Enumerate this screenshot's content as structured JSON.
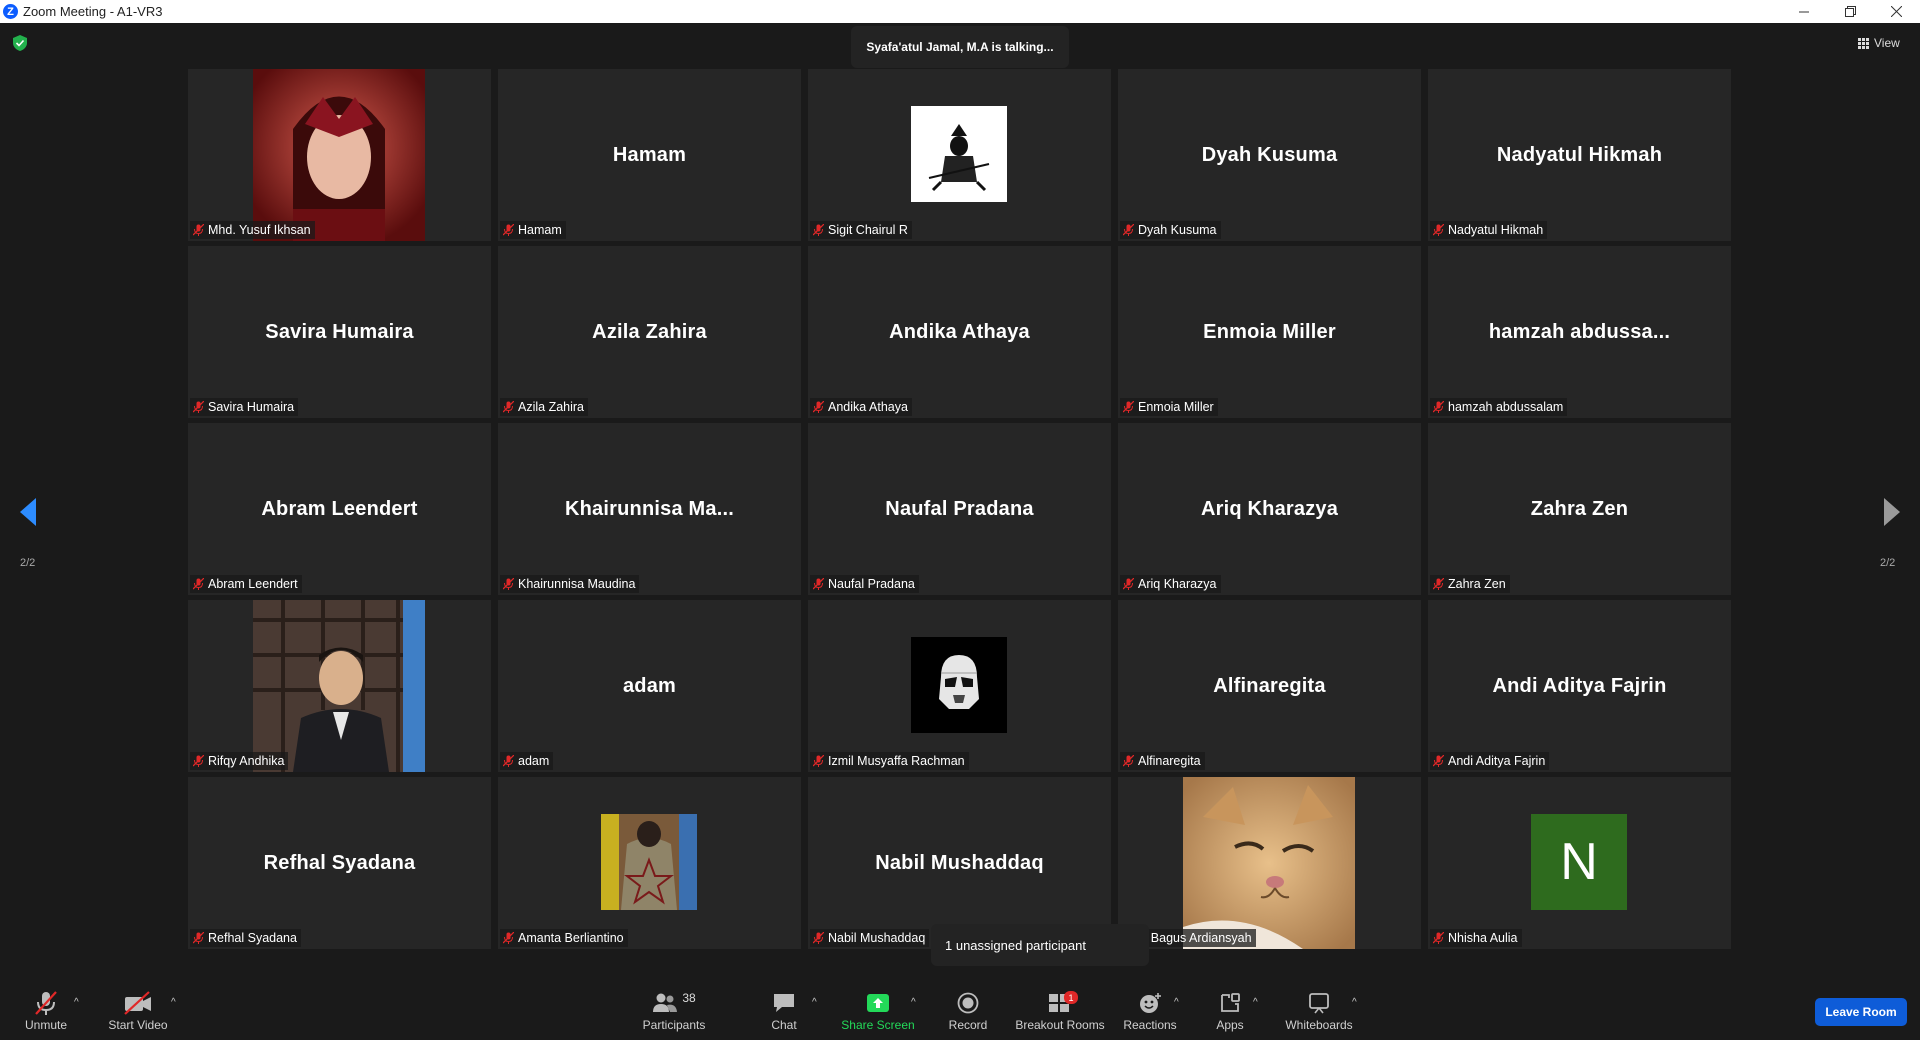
{
  "window": {
    "title": "Zoom Meeting - A1-VR3"
  },
  "banner": {
    "talking": "Syafa'atul Jamal, M.A is talking..."
  },
  "view_button": {
    "label": "View"
  },
  "pager": {
    "left": "2/2",
    "right": "2/2"
  },
  "tiles": [
    {
      "display": "",
      "nameplate": "Mhd. Yusuf Ikhsan",
      "media": "photo-scarlet-witch"
    },
    {
      "display": "Hamam",
      "nameplate": "Hamam",
      "media": "none"
    },
    {
      "display": "",
      "nameplate": "Sigit Chairul R",
      "media": "samurai-logo"
    },
    {
      "display": "Dyah Kusuma",
      "nameplate": "Dyah Kusuma",
      "media": "none"
    },
    {
      "display": "Nadyatul Hikmah",
      "nameplate": "Nadyatul Hikmah",
      "media": "none"
    },
    {
      "display": "Savira Humaira",
      "nameplate": "Savira Humaira",
      "media": "none"
    },
    {
      "display": "Azila Zahira",
      "nameplate": "Azila Zahira",
      "media": "none"
    },
    {
      "display": "Andika Athaya",
      "nameplate": "Andika Athaya",
      "media": "none"
    },
    {
      "display": "Enmoia Miller",
      "nameplate": "Enmoia Miller",
      "media": "none"
    },
    {
      "display": "hamzah  abdussa...",
      "nameplate": "hamzah abdussalam",
      "media": "none"
    },
    {
      "display": "Abram Leendert",
      "nameplate": "Abram Leendert",
      "media": "none"
    },
    {
      "display": "Khairunnisa  Ma...",
      "nameplate": "Khairunnisa Maudina",
      "media": "none"
    },
    {
      "display": "Naufal Pradana",
      "nameplate": "Naufal Pradana",
      "media": "none"
    },
    {
      "display": "Ariq Kharazya",
      "nameplate": "Ariq Kharazya",
      "media": "none"
    },
    {
      "display": "Zahra Zen",
      "nameplate": "Zahra Zen",
      "media": "none"
    },
    {
      "display": "",
      "nameplate": "Rifqy Andhika",
      "media": "photo-portrait"
    },
    {
      "display": "adam",
      "nameplate": "adam",
      "media": "none"
    },
    {
      "display": "",
      "nameplate": "Izmil Musyaffa Rachman",
      "media": "stormtrooper-logo"
    },
    {
      "display": "Alfinaregita",
      "nameplate": "Alfinaregita",
      "media": "none"
    },
    {
      "display": "Andi Aditya Fajrin",
      "nameplate": "Andi Aditya Fajrin",
      "media": "none"
    },
    {
      "display": "Refhal Syadana",
      "nameplate": "Refhal Syadana",
      "media": "none"
    },
    {
      "display": "",
      "nameplate": "Amanta Berliantino",
      "media": "photo-jacket"
    },
    {
      "display": "Nabil Mushaddaq",
      "nameplate": "Nabil Mushaddaq",
      "media": "none"
    },
    {
      "display": "",
      "nameplate": "mad Bagus Ardiansyah",
      "media": "photo-cat"
    },
    {
      "display": "",
      "nameplate": "Nhisha Aulia",
      "media": "letter-avatar",
      "avatar_letter": "N",
      "avatar_color": "#2e6b1e"
    }
  ],
  "tooltip": {
    "text": "1 unassigned participant"
  },
  "toolbar": {
    "unmute": "Unmute",
    "start_video": "Start Video",
    "participants": "Participants",
    "participants_count": "38",
    "chat": "Chat",
    "share_screen": "Share Screen",
    "record": "Record",
    "breakout_rooms": "Breakout Rooms",
    "breakout_badge": "1",
    "reactions": "Reactions",
    "apps": "Apps",
    "whiteboards": "Whiteboards",
    "leave": "Leave Room"
  },
  "colors": {
    "accent": "#0e5cd8",
    "share": "#23d959",
    "badge": "#e02828",
    "nav": "#2d8cff"
  }
}
